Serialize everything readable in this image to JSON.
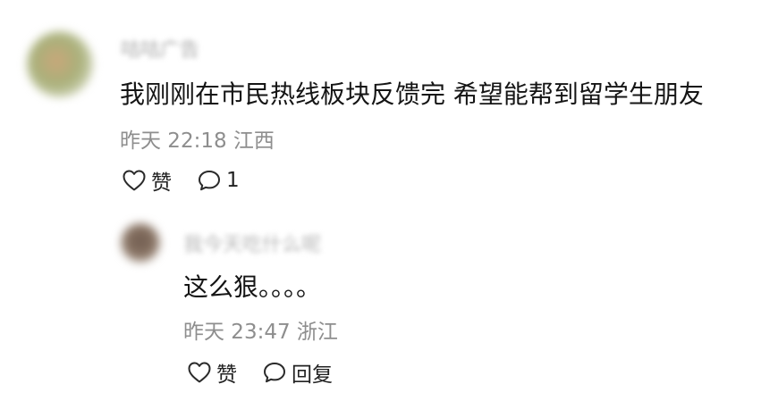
{
  "comment": {
    "username": "咕咕广告",
    "text": "我刚刚在市民热线板块反馈完 希望能帮到留学生朋友",
    "time": "昨天 22:18",
    "location": "江西",
    "like_label": "赞",
    "reply_count": "1"
  },
  "reply": {
    "username": "我今天吃什么呢",
    "text": "这么狠。。。。",
    "time": "昨天 23:47",
    "location": "浙江",
    "like_label": "赞",
    "reply_label": "回复"
  },
  "icons": {
    "like": "heart-outline-icon",
    "comment": "speech-bubble-icon"
  }
}
